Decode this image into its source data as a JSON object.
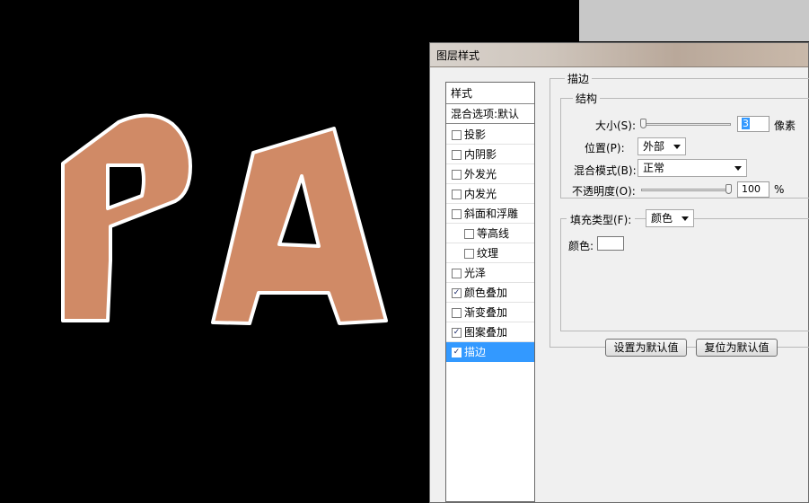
{
  "canvas": {
    "artwork_text": "PA",
    "fill_color": "#d08a66",
    "stroke_color": "#ffffff"
  },
  "dialog": {
    "title": "图层样式",
    "style_list": {
      "header": "样式",
      "blend_options": "混合选项:默认",
      "items": [
        {
          "label": "投影",
          "checked": false
        },
        {
          "label": "内阴影",
          "checked": false
        },
        {
          "label": "外发光",
          "checked": false
        },
        {
          "label": "内发光",
          "checked": false
        },
        {
          "label": "斜面和浮雕",
          "checked": false
        },
        {
          "label": "等高线",
          "checked": false
        },
        {
          "label": "纹理",
          "checked": false
        },
        {
          "label": "光泽",
          "checked": false
        },
        {
          "label": "颜色叠加",
          "checked": true
        },
        {
          "label": "渐变叠加",
          "checked": false
        },
        {
          "label": "图案叠加",
          "checked": true
        },
        {
          "label": "描边",
          "checked": true,
          "selected": true
        }
      ]
    },
    "stroke": {
      "group_label": "描边",
      "structure": {
        "label": "结构",
        "size_label": "大小(S):",
        "size_value": "3",
        "size_unit": "像素",
        "position_label": "位置(P):",
        "position_value": "外部",
        "blend_mode_label": "混合模式(B):",
        "blend_mode_value": "正常",
        "opacity_label": "不透明度(O):",
        "opacity_value": "100",
        "opacity_unit": "%"
      },
      "fill": {
        "fill_type_label": "填充类型(F):",
        "fill_type_value": "颜色",
        "color_label": "颜色:",
        "color_value": "#ffffff"
      }
    },
    "buttons": {
      "make_default": "设置为默认值",
      "reset_default": "复位为默认值"
    }
  }
}
